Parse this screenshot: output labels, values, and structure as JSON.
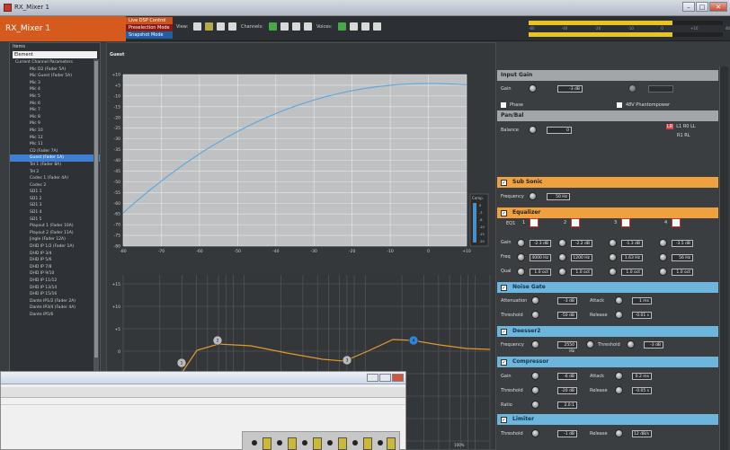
{
  "window": {
    "title": "RX_Mixer 1"
  },
  "toolbar": {
    "device_name": "RX_Mixer 1",
    "modes": [
      "Live DSP Control",
      "Preselection Mode",
      "Snapshot Mode"
    ],
    "view_label": "View:",
    "channels_label": "Channels:",
    "voices_label": "Voices:",
    "meter_scale": [
      "-60",
      "-40",
      "-20",
      "-10",
      "0",
      "+10",
      "dB"
    ]
  },
  "tree": {
    "header": "Items",
    "selector": "Element",
    "items": [
      "Current Channel Parameters",
      "Mic   D2 (Fader 5A)",
      "Mic   Guest (Fader 5A)",
      "Mic 3",
      "Mic 4",
      "Mic 5",
      "Mic 6",
      "Mic 7",
      "Mic 8",
      "Mic 9",
      "Mic 10",
      "Mic 12",
      "Mic 11",
      "CD (Fader 7A)",
      "Guest (Fader 1A)",
      "Tel 1 (Fader 8A)",
      "Tel 2",
      "Codec 1 (Fader 4A)",
      "Codec 2",
      "SD1 1",
      "SD1 2",
      "SD1 3",
      "SD1 4",
      "SD1 5",
      "Playout 1 (Fader 10A)",
      "Playout 2 (Fader 11A)",
      "Jingle (Fader 12A)",
      "DHD IP  1/2 (Fader 1A)",
      "DHD IP  3/4",
      "DHD IP  5/6",
      "DHD IP  7/8",
      "DHD IP  9/10",
      "DHD IP  11/12",
      "DHD IP  13/14",
      "DHD IP  15/16",
      "Dante IP1/2 (Fader 2A)",
      "Dante IP3/4 (Fader 4A)",
      "Dante IP5/6"
    ],
    "active_index": 14
  },
  "graph": {
    "caption": "Guest",
    "top_y_labels": [
      "+10",
      "+5",
      "-10",
      "-15",
      "-20",
      "-25",
      "-30",
      "-35",
      "-40",
      "-45",
      "-50",
      "-55",
      "-60",
      "-65",
      "-70",
      "-75",
      "-80"
    ],
    "top_x_labels": [
      "-80",
      "-70",
      "-60",
      "-50",
      "-40",
      "-30",
      "-20",
      "-10",
      "0",
      "+10"
    ],
    "comp_label": "Comp.",
    "comp_scale": [
      "0",
      "-3",
      "-6",
      "-10",
      "-15",
      "-20"
    ],
    "eq_y_labels": [
      "+15",
      "+10",
      "+5",
      "0"
    ],
    "eq_bottom_label": "100%",
    "eq_points": [
      "1",
      "2",
      "3",
      "4"
    ]
  },
  "params": {
    "input_gain": {
      "title": "Input Gain",
      "gain_label": "Gain",
      "gain_value": "-3 dB",
      "phase_label": "Phase",
      "phantom_label": "48V Phantompower"
    },
    "pan_bal": {
      "title": "Pan/Bal",
      "balance_label": "Balance",
      "balance_value": "0",
      "routing": "LR",
      "opt1": "L1  R0  LL",
      "opt2": "R1  RL"
    },
    "sub_sonic": {
      "title": "Sub Sonic",
      "frequency_label": "Frequency",
      "frequency_value": "50 Hz"
    },
    "equalizer": {
      "title": "Equalizer",
      "eq_label": "EQ1",
      "bands": [
        "1",
        "2",
        "3",
        "4"
      ],
      "gain_label": "Gain",
      "freq_label": "Freq",
      "qual_label": "Qual",
      "gain_values": [
        "-2.3 dB",
        "-2.2 dB",
        "-1.3 dB",
        "-3.5 dB"
      ],
      "freq_values": [
        "4000 Hz",
        "1200 Hz",
        "1.63 Hz",
        "56 Hz"
      ],
      "qual_values": [
        "1.0 oct",
        "1.0 oct",
        "1.0 oct",
        "1.0 oct"
      ]
    },
    "noise_gate": {
      "title": "Noise Gate",
      "attenuation_label": "Attenuation",
      "attenuation_value": "-3 dB",
      "attack_label": "Attack",
      "attack_value": "1 ms",
      "threshold_label": "Threshold",
      "threshold_value": "-50 dB",
      "release_label": "Release",
      "release_value": "-0.01 s"
    },
    "deesser": {
      "title": "Deesser2",
      "frequency_label": "Frequency",
      "frequency_value": "2550 Hz",
      "threshold_label": "Threshold",
      "threshold_value": "-3 dB"
    },
    "compressor": {
      "title": "Compressor",
      "gain_label": "Gain",
      "gain_value": "-6 dB",
      "attack_label": "Attack",
      "attack_value": "0.2 ms",
      "threshold_label": "Threshold",
      "threshold_value": "-20 dB",
      "release_label": "Release",
      "release_value": "-0.05 s",
      "ratio_label": "Ratio",
      "ratio_value": "2.0:1"
    },
    "limiter": {
      "title": "Limiter",
      "threshold_label": "Threshold",
      "threshold_value": "-1 dB",
      "release_label": "Release",
      "release_value": "12 dB/s"
    }
  },
  "colors": {
    "accent": "#d45a1e",
    "orange_section": "#f0a03c",
    "blue_section": "#6cb6de",
    "curve": "#5aa7dd",
    "eq_curve": "#e09a2a",
    "selected": "#3f7fd0"
  }
}
